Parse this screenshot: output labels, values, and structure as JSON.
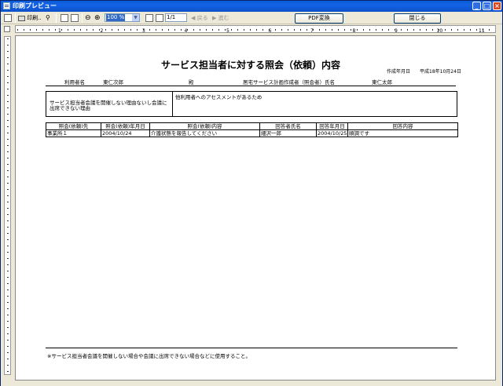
{
  "window": {
    "title": "印刷プレビュー"
  },
  "toolbar": {
    "print_label": "印刷",
    "zoom_value": "100 %",
    "page_value": "1/1",
    "back_label": "戻る",
    "forward_label": "進む",
    "pdf_label": "PDF変換",
    "close_label": "閉じる"
  },
  "ruler": {
    "numbers": [
      "1",
      "2",
      "3",
      "4",
      "5",
      "6",
      "7",
      "8",
      "9",
      "10",
      "11"
    ]
  },
  "report": {
    "title": "サービス担当者に対する照会（依頼）内容",
    "created_label": "作成年月日",
    "created_date": "平成18年10月24日",
    "user_label": "利用者名",
    "user_name": "東仁次郎",
    "honorific": "殿",
    "planner_label": "居宅サービス計画作成者（照会者）氏名",
    "planner_name": "東仁太郎",
    "reason_label": "サービス担当者会議を開催しない理由ないし会議に出席できない理由",
    "reason_value": "他利用者へのアセスメントがあるため",
    "table": {
      "headers": [
        "照会(依頼)先",
        "照会(依頼)年月日",
        "照会(依頼)内容",
        "回答者氏名",
        "回答年月日",
        "回答内容"
      ],
      "rows": [
        [
          "事業所１",
          "2004/10/24",
          "介護状態を報告してください",
          "細沢一郎",
          "2004/10/25",
          "順調です"
        ]
      ]
    },
    "footer_note": "※サービス担当者会議を開催しない場合や会議に出席できない場合などに使用すること。"
  }
}
